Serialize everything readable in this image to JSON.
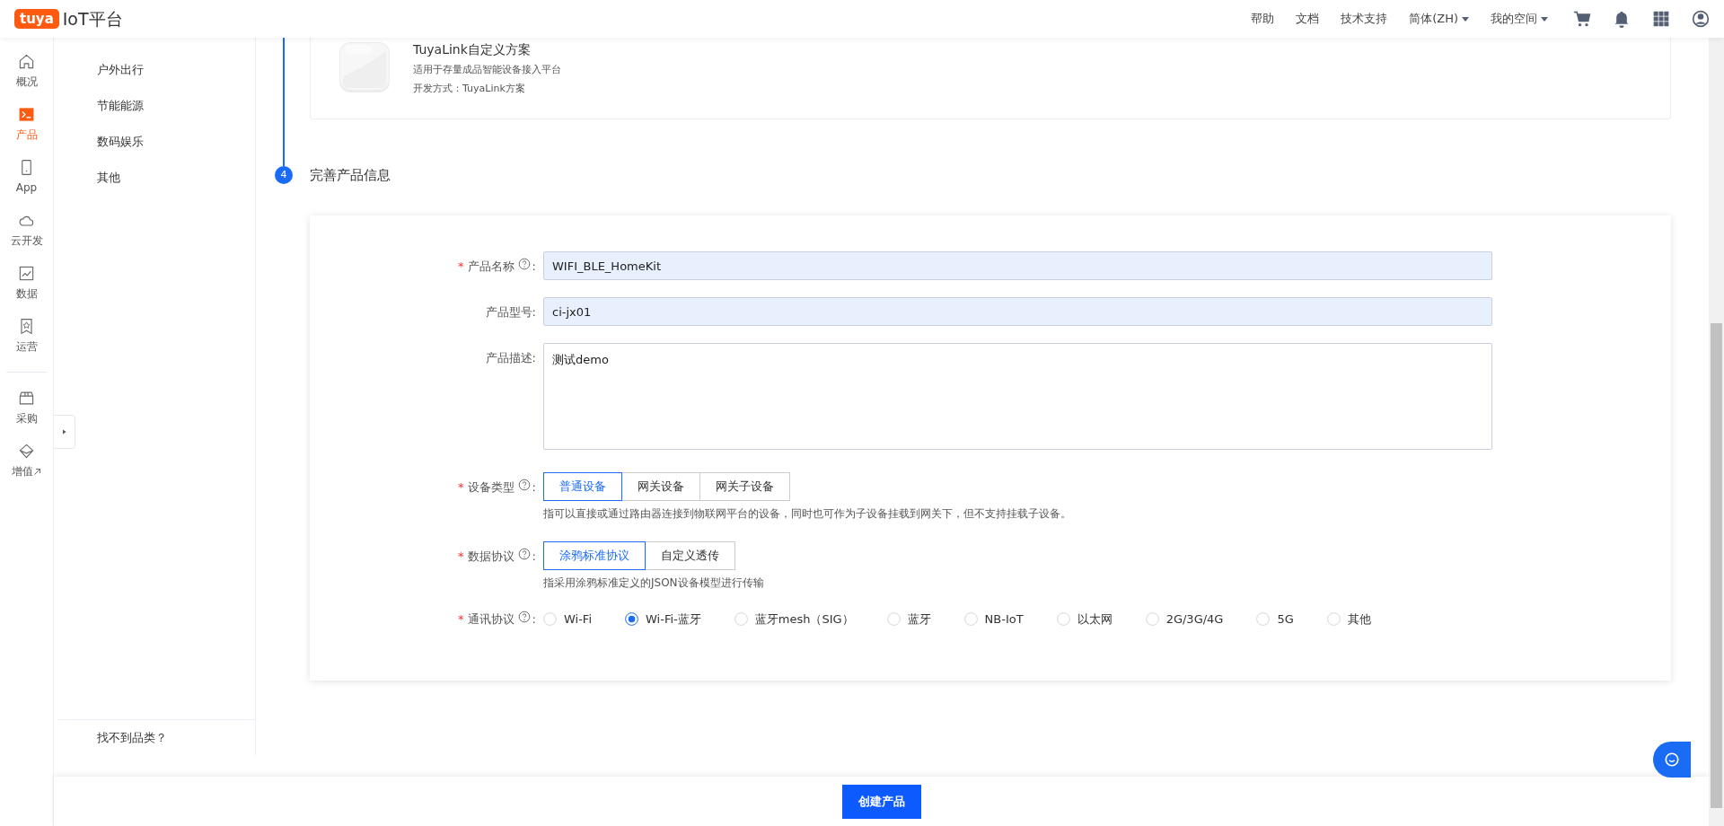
{
  "header": {
    "logo": "tuya",
    "title": "IoT平台",
    "links": [
      {
        "label": "帮助",
        "dropdown": false
      },
      {
        "label": "文档",
        "dropdown": false
      },
      {
        "label": "技术支持",
        "dropdown": false
      },
      {
        "label": "简体(ZH)",
        "dropdown": true
      },
      {
        "label": "我的空间",
        "dropdown": true
      }
    ]
  },
  "rail": {
    "items": [
      {
        "label": "概况",
        "selected": false
      },
      {
        "label": "产品",
        "selected": true
      },
      {
        "label": "App",
        "selected": false
      },
      {
        "label": "云开发",
        "selected": false
      },
      {
        "label": "数据",
        "selected": false
      },
      {
        "label": "运营",
        "selected": false
      }
    ],
    "more_items": [
      {
        "label": "采购",
        "selected": false,
        "external": false
      },
      {
        "label": "增值",
        "selected": false,
        "external": true
      }
    ]
  },
  "categories": {
    "items": [
      {
        "label": "户外出行"
      },
      {
        "label": "节能能源"
      },
      {
        "label": "数码娱乐"
      },
      {
        "label": "其他"
      }
    ],
    "footer": "找不到品类？"
  },
  "scheme_card": {
    "title": "TuyaLink自定义方案",
    "description": "适用于存量成品智能设备接入平台",
    "method": "开发方式：TuyaLink方案"
  },
  "step": {
    "number": "4",
    "title": "完善产品信息"
  },
  "form": {
    "fields": [
      {
        "kind": "text",
        "required_mark": "*",
        "label": "产品名称",
        "help": true,
        "suffix": ":",
        "value": "WIFI_BLE_HomeKit"
      },
      {
        "kind": "text",
        "label": "产品型号:",
        "help": false,
        "value": "ci-jx01"
      },
      {
        "kind": "textarea",
        "label": "产品描述:",
        "help": false,
        "value": "测试demo"
      },
      {
        "kind": "segmented",
        "required_mark": "*",
        "label": "设备类型",
        "help": true,
        "suffix": ":",
        "options": [
          {
            "label": "普通设备",
            "selected": true
          },
          {
            "label": "网关设备",
            "selected": false
          },
          {
            "label": "网关子设备",
            "selected": false
          }
        ],
        "hint": "指可以直接或通过路由器连接到物联网平台的设备，同时也可作为子设备挂载到网关下，但不支持挂载子设备。"
      },
      {
        "kind": "segmented",
        "required_mark": "*",
        "label": "数据协议",
        "help": true,
        "suffix": ":",
        "options": [
          {
            "label": "涂鸦标准协议",
            "selected": true
          },
          {
            "label": "自定义透传",
            "selected": false
          }
        ],
        "hint": "指采用涂鸦标准定义的JSON设备模型进行传输"
      },
      {
        "kind": "radio",
        "required_mark": "*",
        "label": "通讯协议",
        "help": true,
        "suffix": ":",
        "options": [
          {
            "label": "Wi-Fi",
            "selected": false
          },
          {
            "label": "Wi-Fi-蓝牙",
            "selected": true
          },
          {
            "label": "蓝牙mesh（SIG）",
            "selected": false
          },
          {
            "label": "蓝牙",
            "selected": false
          },
          {
            "label": "NB-IoT",
            "selected": false
          },
          {
            "label": "以太网",
            "selected": false
          },
          {
            "label": "2G/3G/4G",
            "selected": false
          },
          {
            "label": "5G",
            "selected": false
          },
          {
            "label": "其他",
            "selected": false
          }
        ]
      }
    ]
  },
  "create_button": "创建产品"
}
